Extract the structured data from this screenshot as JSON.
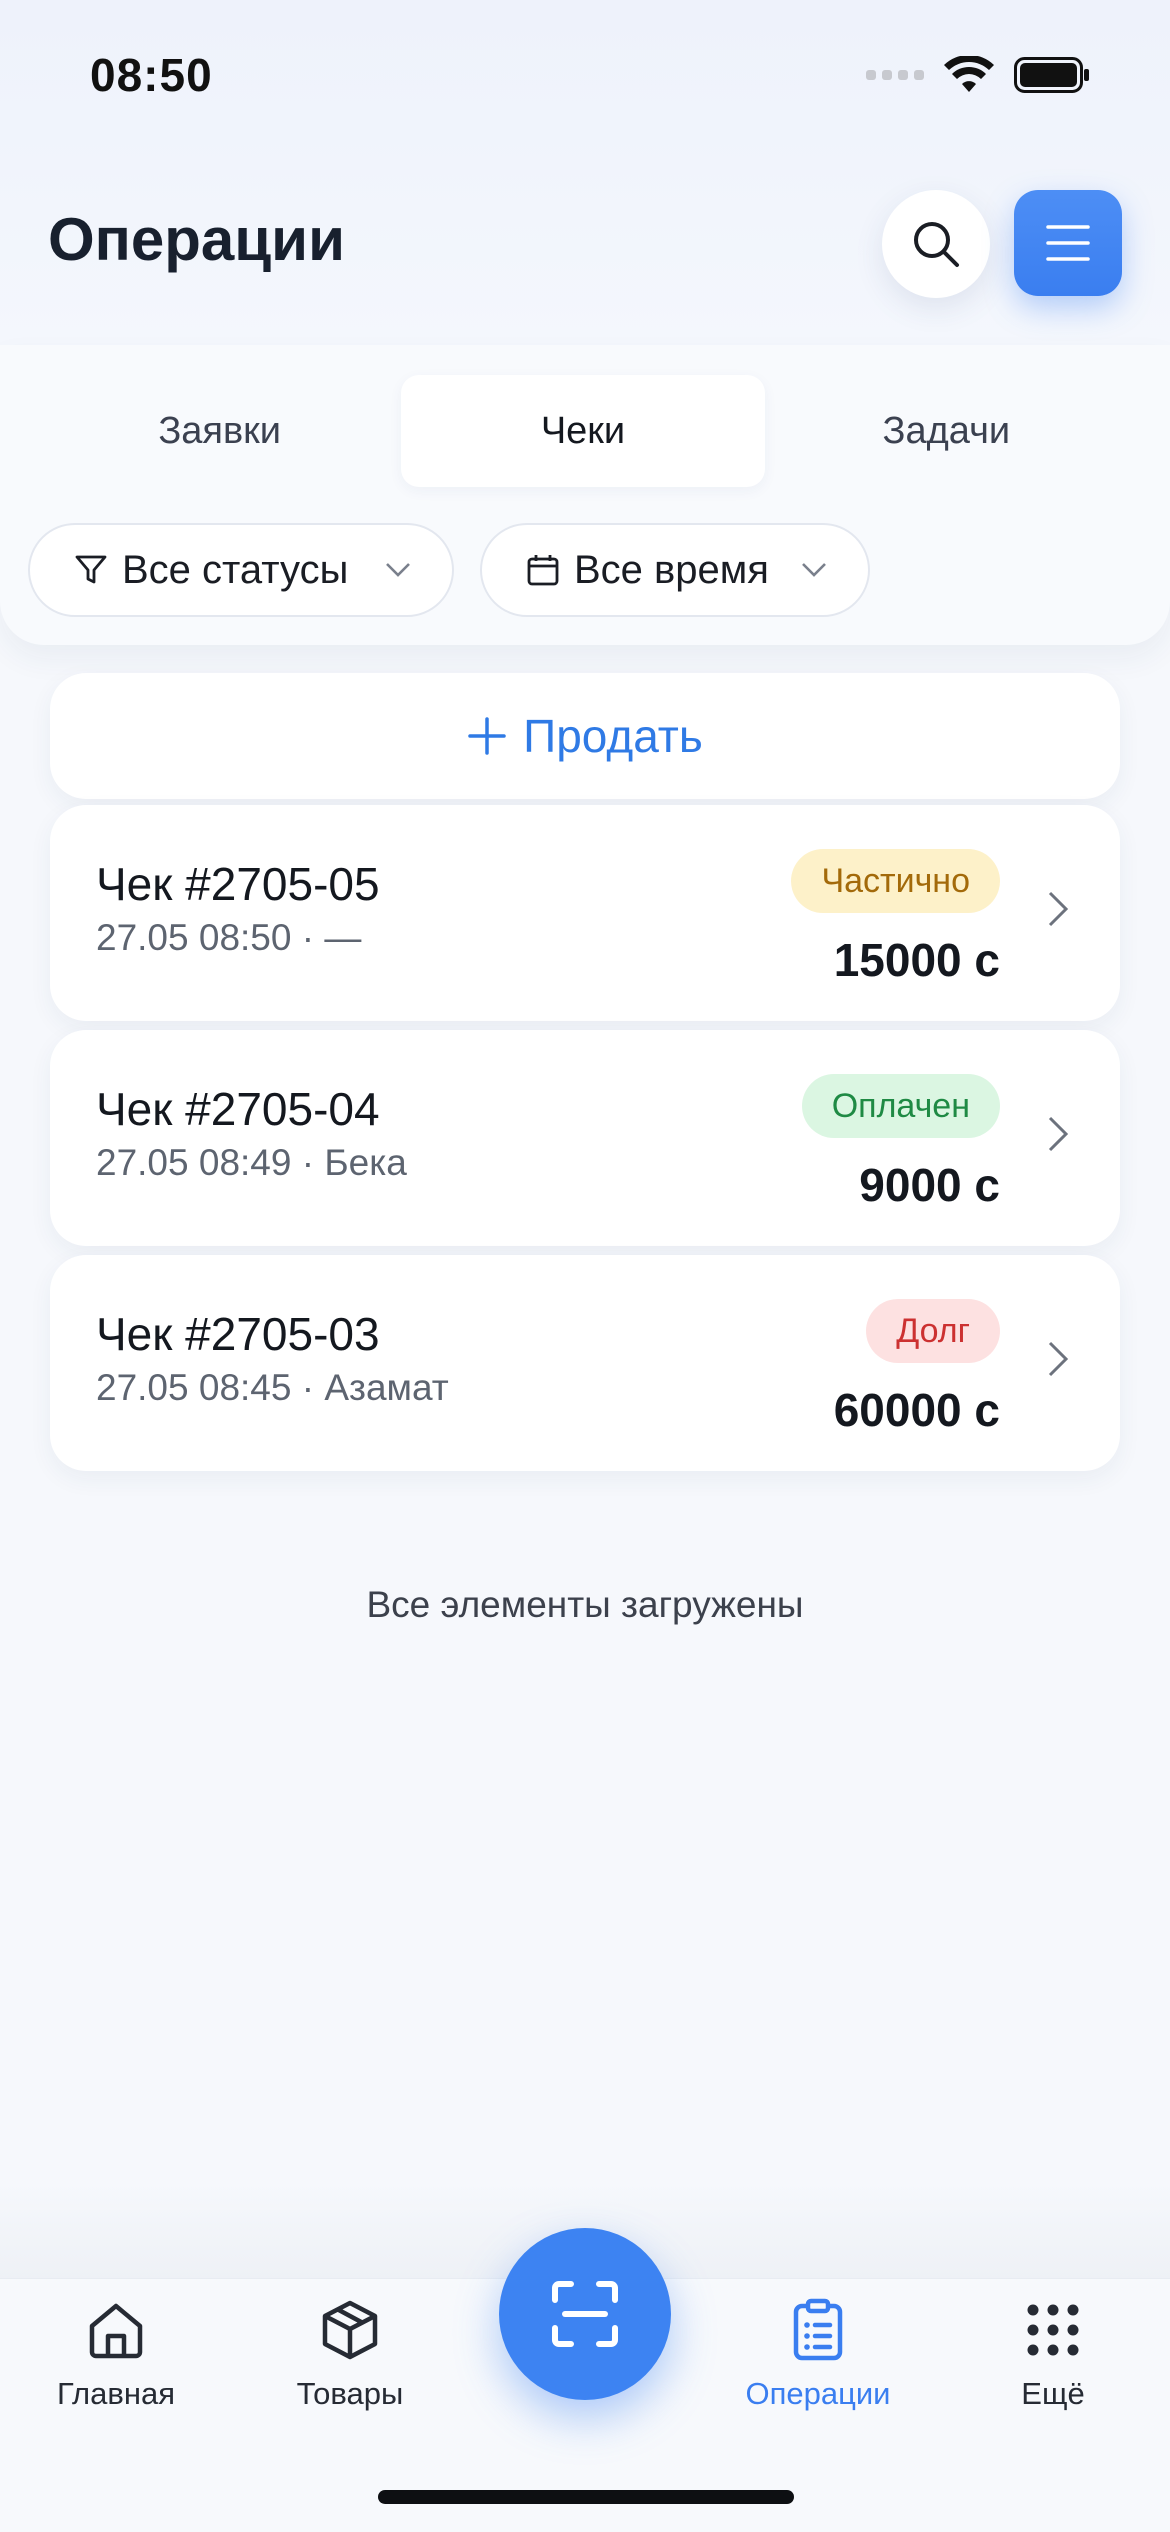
{
  "status_bar": {
    "time": "08:50"
  },
  "header": {
    "title": "Операции"
  },
  "tabs": [
    {
      "label": "Заявки",
      "active": false
    },
    {
      "label": "Чеки",
      "active": true
    },
    {
      "label": "Задачи",
      "active": false
    }
  ],
  "filters": {
    "status_label": "Все статусы",
    "time_label": "Все время"
  },
  "sell_button": {
    "label": "Продать"
  },
  "receipts": [
    {
      "title": "Чек #2705-05",
      "subtitle": "27.05 08:50 · —",
      "badge": "Частично",
      "amount": "15000 с",
      "badge_bg": "#fdf1c9",
      "badge_color": "#a36a0a"
    },
    {
      "title": "Чек #2705-04",
      "subtitle": "27.05 08:49 · Бека",
      "badge": "Оплачен",
      "amount": "9000 с",
      "badge_bg": "#dbf6e2",
      "badge_color": "#1f8a44"
    },
    {
      "title": "Чек #2705-03",
      "subtitle": "27.05 08:45 · Азамат",
      "badge": "Долг",
      "amount": "60000 с",
      "badge_bg": "#fde1e1",
      "badge_color": "#cc3131"
    }
  ],
  "loaded_note": "Все элементы загружены",
  "bottom_nav": {
    "home": "Главная",
    "products": "Товары",
    "operations": "Операции",
    "more": "Ещё"
  },
  "colors": {
    "accent": "#3a7ef0",
    "background": "#f6f8fc"
  }
}
